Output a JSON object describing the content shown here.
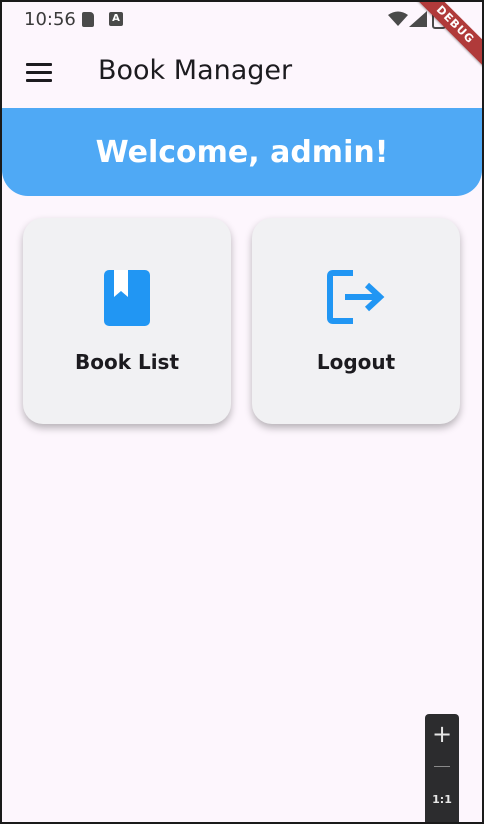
{
  "status_bar": {
    "time": "10:56",
    "a_badge": "A",
    "icons": [
      "sd-card-icon",
      "a-badge-icon",
      "wifi-icon",
      "signal-icon",
      "battery-icon"
    ]
  },
  "debug_banner": "DEBUG",
  "app_bar": {
    "title": "Book Manager",
    "menu_icon": "menu-icon"
  },
  "welcome": {
    "text": "Welcome, admin!",
    "color": "#4fa9f5"
  },
  "cards": [
    {
      "label": "Book List",
      "icon": "book-icon",
      "icon_color": "#2196f3"
    },
    {
      "label": "Logout",
      "icon": "logout-icon",
      "icon_color": "#2196f3"
    }
  ],
  "zoom": {
    "plus": "+",
    "reset": "1:1"
  }
}
